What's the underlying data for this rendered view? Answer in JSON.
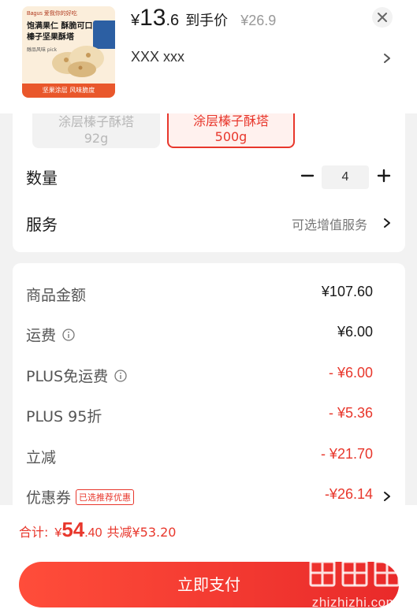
{
  "product": {
    "thumb_brand": "Bagus 爱我你的好吃",
    "thumb_line1": "饱满果仁 酥脆可口",
    "thumb_line2": "榛子坚果酥塔",
    "thumb_small": "醇品风味 pick",
    "thumb_bottom": "坚果涂层  风味脆度",
    "price_symbol": "¥",
    "price_int": "13",
    "price_dec": ".6",
    "price_tag": "到手价",
    "price_original": "¥26.9",
    "spec": "XXX  xxx",
    "close_icon": "close-icon",
    "chevron_icon": "chevron-right-icon"
  },
  "options": [
    {
      "line1": "涂层榛子酥塔",
      "line2": "92g",
      "selected": false
    },
    {
      "line1": "涂层榛子酥塔",
      "line2": "500g",
      "selected": true
    }
  ],
  "quantity": {
    "label": "数量",
    "value": "4",
    "minus_icon": "minus-icon",
    "plus_icon": "plus-icon"
  },
  "service": {
    "label": "服务",
    "value": "可选增值服务"
  },
  "price_details": [
    {
      "label": "商品金额",
      "value": "¥107.60",
      "red": false,
      "info": false
    },
    {
      "label": "运费",
      "value": "¥6.00",
      "red": false,
      "info": true
    },
    {
      "label": "PLUS免运费",
      "value": "- ¥6.00",
      "red": true,
      "info": true
    },
    {
      "label": "PLUS 95折",
      "value": "- ¥5.36",
      "red": true,
      "info": false
    },
    {
      "label": "立减",
      "value": "- ¥21.70",
      "red": true,
      "info": false
    },
    {
      "label": "优惠券",
      "value": "-¥26.14",
      "red": true,
      "info": false,
      "badge": "已选推荐优惠"
    }
  ],
  "footer": {
    "total_label": "合计:",
    "total_yen": "¥",
    "total_int": "54",
    "total_dec": ".40",
    "saved": "共减¥53.20",
    "pay_label": "立即支付",
    "watermark": "zhizhizhi.com"
  },
  "colors": {
    "accent": "#e8372c",
    "background": "#f2f2f2"
  }
}
